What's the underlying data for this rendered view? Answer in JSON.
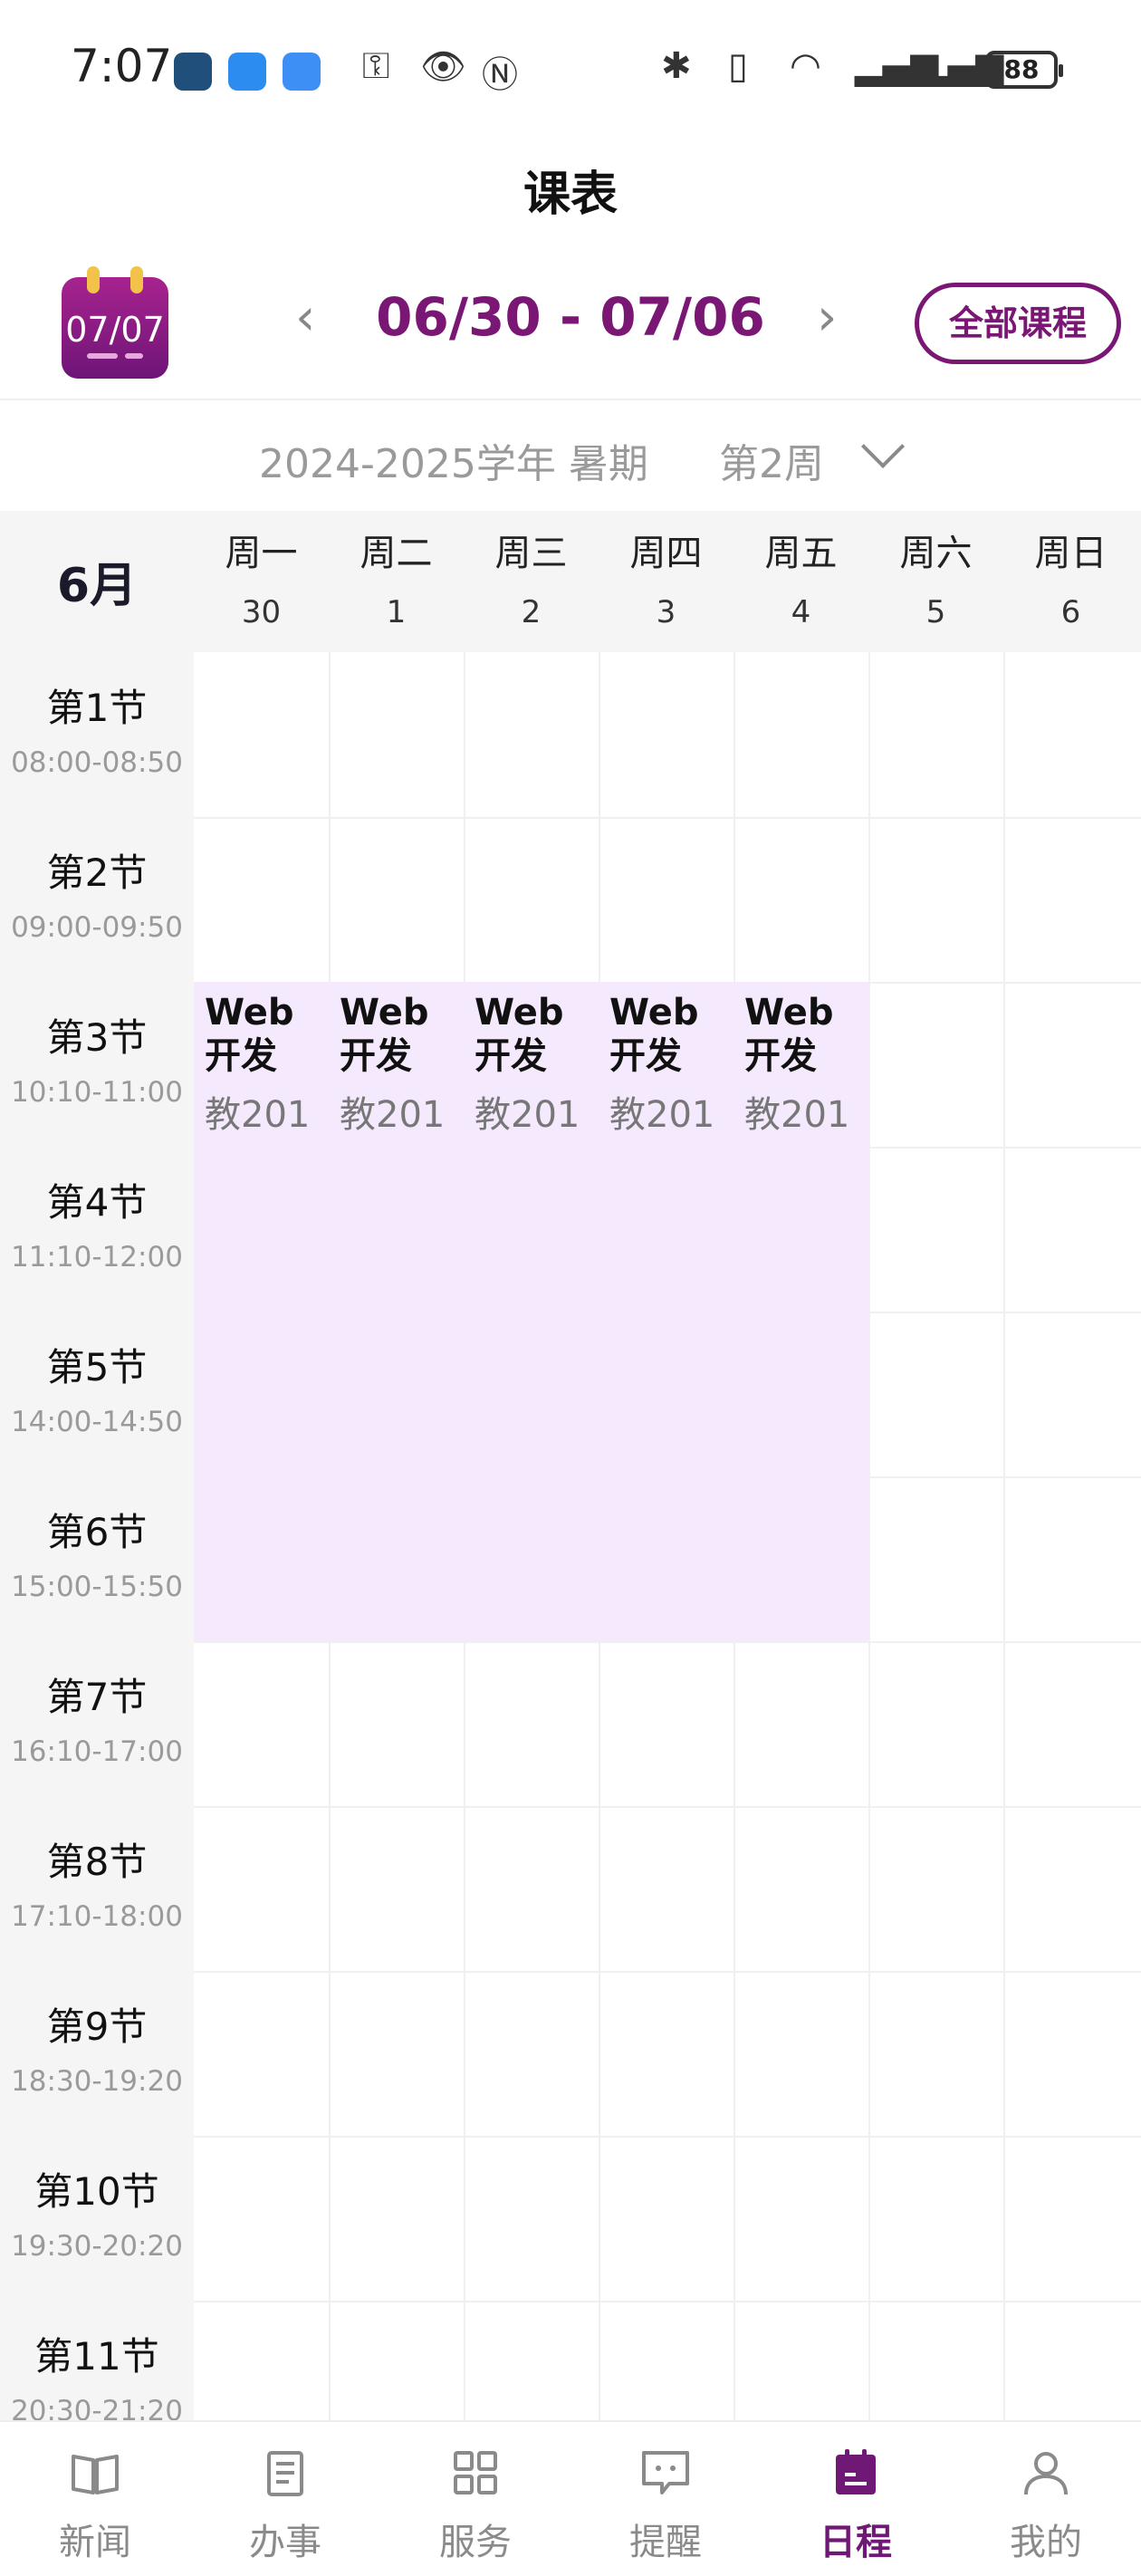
{
  "status_bar": {
    "time": "7:07",
    "battery": "88",
    "icons": [
      "vpn-key-icon",
      "eye-icon",
      "nfc-icon",
      "bluetooth-icon",
      "vibrate-icon",
      "wifi-icon",
      "signal-icon",
      "signal-icon"
    ]
  },
  "header": {
    "title": "课表",
    "badge_date": "07/07",
    "date_range": "06/30 - 07/06",
    "prev_icon": "chevron-left-icon",
    "next_icon": "chevron-right-icon",
    "all_courses": "全部课程"
  },
  "term": {
    "label": "2024-2025学年 暑期",
    "week": "第2周"
  },
  "schedule": {
    "month": "6月",
    "days": [
      {
        "name": "周一",
        "date": "30"
      },
      {
        "name": "周二",
        "date": "1"
      },
      {
        "name": "周三",
        "date": "2"
      },
      {
        "name": "周四",
        "date": "3"
      },
      {
        "name": "周五",
        "date": "4"
      },
      {
        "name": "周六",
        "date": "5"
      },
      {
        "name": "周日",
        "date": "6"
      }
    ],
    "periods": [
      {
        "name": "第1节",
        "time": "08:00-08:50"
      },
      {
        "name": "第2节",
        "time": "09:00-09:50"
      },
      {
        "name": "第3节",
        "time": "10:10-11:00"
      },
      {
        "name": "第4节",
        "time": "11:10-12:00"
      },
      {
        "name": "第5节",
        "time": "14:00-14:50"
      },
      {
        "name": "第6节",
        "time": "15:00-15:50"
      },
      {
        "name": "第7节",
        "time": "16:10-17:00"
      },
      {
        "name": "第8节",
        "time": "17:10-18:00"
      },
      {
        "name": "第9节",
        "time": "18:30-19:20"
      },
      {
        "name": "第10节",
        "time": "19:30-20:20"
      },
      {
        "name": "第11节",
        "time": "20:30-21:20"
      }
    ],
    "courses": [
      {
        "name": "Web开发",
        "room": "教201",
        "day": "周一",
        "periods": "第3节-第6节"
      },
      {
        "name": "Web开发",
        "room": "教201",
        "day": "周二",
        "periods": "第3节-第6节"
      },
      {
        "name": "Web开发",
        "room": "教201",
        "day": "周三",
        "periods": "第3节-第6节"
      },
      {
        "name": "Web开发",
        "room": "教201",
        "day": "周四",
        "periods": "第3节-第6节"
      },
      {
        "name": "Web开发",
        "room": "教201",
        "day": "周五",
        "periods": "第3节-第6节"
      }
    ],
    "course_color": "#f5eafd"
  },
  "bottom_nav": {
    "items": [
      {
        "label": "新闻",
        "icon": "book-icon"
      },
      {
        "label": "办事",
        "icon": "document-icon"
      },
      {
        "label": "服务",
        "icon": "grid-icon"
      },
      {
        "label": "提醒",
        "icon": "message-icon"
      },
      {
        "label": "日程",
        "icon": "calendar-icon"
      },
      {
        "label": "我的",
        "icon": "person-icon"
      }
    ],
    "active": "日程",
    "active_color": "#6f1875"
  }
}
